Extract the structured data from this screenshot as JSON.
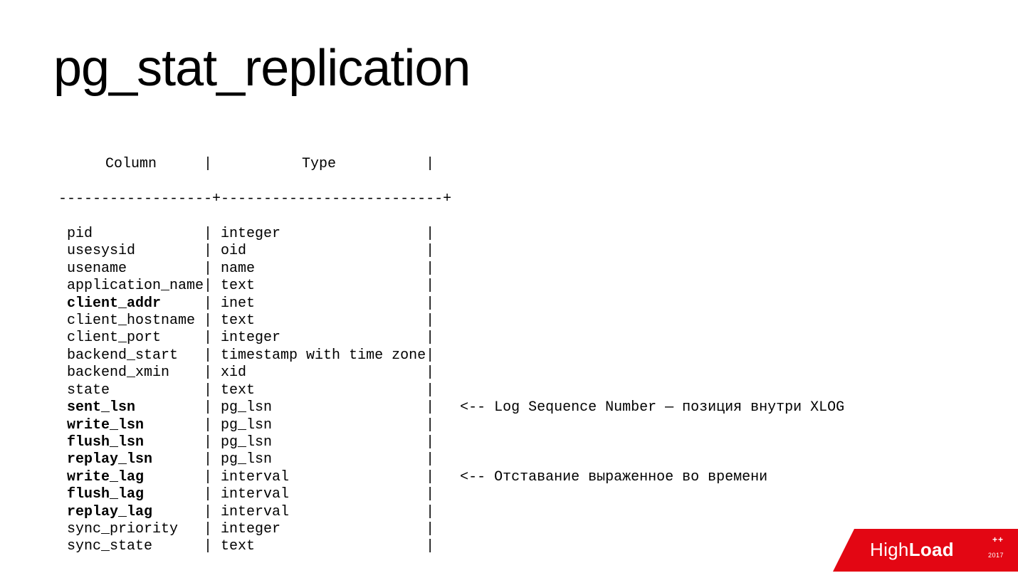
{
  "title": "pg_stat_replication",
  "headers": {
    "col1": "Column",
    "col2": "Type"
  },
  "separator": "------------------+--------------------------+",
  "rows": [
    {
      "col": "pid",
      "type": "integer",
      "bold": false,
      "note": ""
    },
    {
      "col": "usesysid",
      "type": "oid",
      "bold": false,
      "note": ""
    },
    {
      "col": "usename",
      "type": "name",
      "bold": false,
      "note": ""
    },
    {
      "col": "application_name",
      "type": "text",
      "bold": false,
      "note": ""
    },
    {
      "col": "client_addr",
      "type": "inet",
      "bold": true,
      "note": ""
    },
    {
      "col": "client_hostname",
      "type": "text",
      "bold": false,
      "note": ""
    },
    {
      "col": "client_port",
      "type": "integer",
      "bold": false,
      "note": ""
    },
    {
      "col": "backend_start",
      "type": "timestamp with time zone",
      "bold": false,
      "note": ""
    },
    {
      "col": "backend_xmin",
      "type": "xid",
      "bold": false,
      "note": ""
    },
    {
      "col": "state",
      "type": "text",
      "bold": false,
      "note": ""
    },
    {
      "col": "sent_lsn",
      "type": "pg_lsn",
      "bold": true,
      "note": "   <-- Log Sequence Number — позиция внутри XLOG"
    },
    {
      "col": "write_lsn",
      "type": "pg_lsn",
      "bold": true,
      "note": ""
    },
    {
      "col": "flush_lsn",
      "type": "pg_lsn",
      "bold": true,
      "note": ""
    },
    {
      "col": "replay_lsn",
      "type": "pg_lsn",
      "bold": true,
      "note": ""
    },
    {
      "col": "write_lag",
      "type": "interval",
      "bold": true,
      "note": "   <-- Отставание выраженное во времени"
    },
    {
      "col": "flush_lag",
      "type": "interval",
      "bold": true,
      "note": ""
    },
    {
      "col": "replay_lag",
      "type": "interval",
      "bold": true,
      "note": ""
    },
    {
      "col": "sync_priority",
      "type": "integer",
      "bold": false,
      "note": ""
    },
    {
      "col": "sync_state",
      "type": "text",
      "bold": false,
      "note": ""
    }
  ],
  "logo": {
    "brand_a": "High",
    "brand_b": "Load",
    "plus": "++",
    "year": "2017"
  }
}
